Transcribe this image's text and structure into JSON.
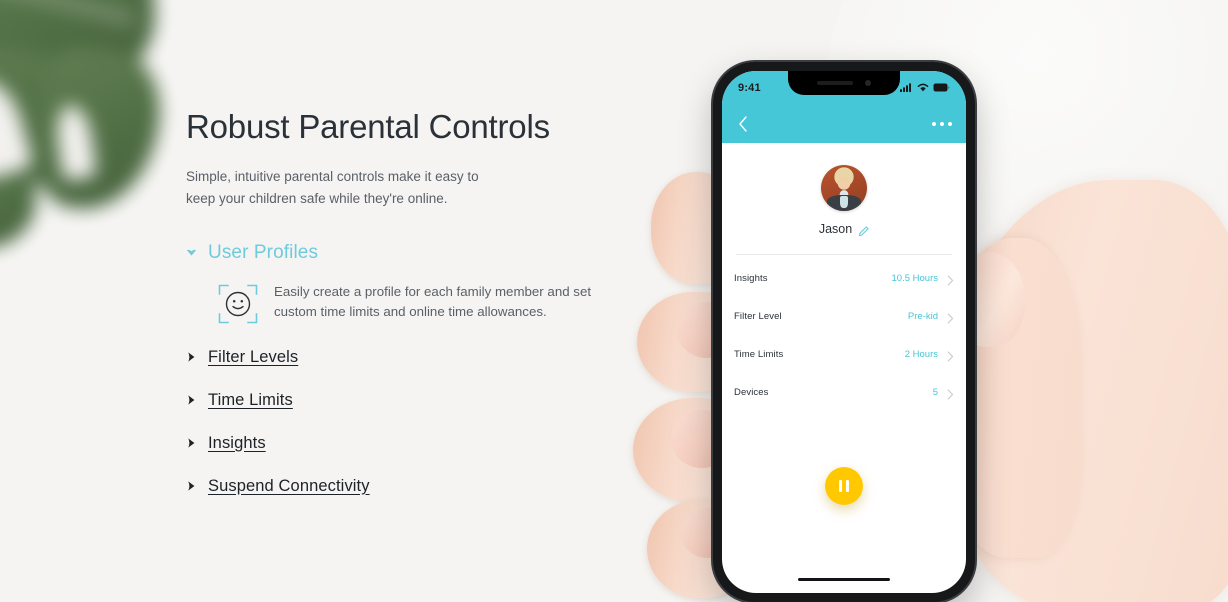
{
  "theme": {
    "background": "#f5f4f2",
    "accent_teal": "#45c7d7",
    "accent_teal_light": "#6ecbdc",
    "accent_yellow": "#ffc800",
    "text_dark": "#2b3138",
    "text_muted": "#5a6068"
  },
  "hero": {
    "headline": "Robust Parental Controls",
    "subcopy_line1": "Simple, intuitive parental controls make it easy to",
    "subcopy_line2": "keep your children safe while they're online."
  },
  "accordion": {
    "expanded": {
      "title": "User Profiles",
      "chevron_icon": "chevron-down-icon",
      "feature_icon": "smiley-face-scan-icon",
      "body_line1": "Easily create a profile for each family member and set",
      "body_line2": "custom time limits and online time allowances."
    },
    "collapsed": [
      {
        "title": "Filter Levels",
        "chevron_icon": "chevron-right-icon"
      },
      {
        "title": "Time Limits",
        "chevron_icon": "chevron-right-icon"
      },
      {
        "title": "Insights",
        "chevron_icon": "chevron-right-icon"
      },
      {
        "title": "Suspend Connectivity",
        "chevron_icon": "chevron-right-icon"
      }
    ]
  },
  "phone": {
    "status_bar": {
      "time": "9:41",
      "signal_icon": "cellular-signal-icon",
      "wifi_icon": "wifi-icon",
      "battery_icon": "battery-full-icon"
    },
    "app_bar": {
      "back_icon": "back-chevron-icon",
      "overflow_icon": "more-options-icon"
    },
    "profile": {
      "avatar_icon": "user-avatar-photo",
      "name": "Jason",
      "edit_icon": "pencil-edit-icon"
    },
    "rows": [
      {
        "label": "Insights",
        "value": "10.5 Hours",
        "chevron_icon": "chevron-right-icon"
      },
      {
        "label": "Filter Level",
        "value": "Pre-kid",
        "chevron_icon": "chevron-right-icon"
      },
      {
        "label": "Time Limits",
        "value": "2 Hours",
        "chevron_icon": "chevron-right-icon"
      },
      {
        "label": "Devices",
        "value": "5",
        "chevron_icon": "chevron-right-icon"
      }
    ],
    "fab": {
      "icon": "pause-icon"
    },
    "home_indicator": "home-indicator-bar"
  },
  "decor": {
    "leaf": "monstera-leaf-blurred",
    "hand": "hand-holding-phone"
  }
}
